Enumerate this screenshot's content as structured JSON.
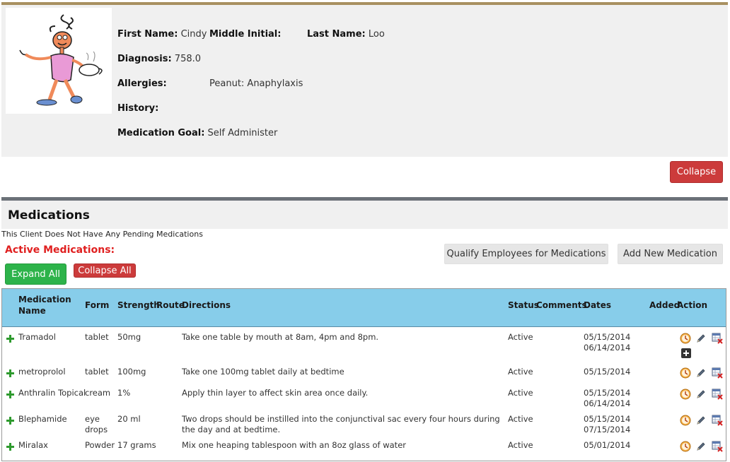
{
  "patient": {
    "first_name_label": "First Name:",
    "first_name": "Cindy",
    "middle_initial_label": "Middle Initial:",
    "middle_initial": "",
    "last_name_label": "Last Name:",
    "last_name": "Loo",
    "diagnosis_label": "Diagnosis:",
    "diagnosis": "758.0",
    "allergies_label": "Allergies:",
    "allergies": "Peanut: Anaphylaxis",
    "history_label": "History:",
    "history": "",
    "goal_label": "Medication Goal:",
    "goal": "Self Administer",
    "avatar_icon": "cartoon-character-icon"
  },
  "collapse_label": "Collapse",
  "medications": {
    "title": "Medications",
    "pending_text": "This Client Does Not Have Any Pending Medications",
    "active_title": "Active Medications:",
    "qualify_label": "Qualify Employees for Medications",
    "add_label": "Add New Medication",
    "expand_all_label": "Expand All",
    "collapse_all_label": "Collapse All",
    "columns": {
      "name": "Medication Name",
      "form": "Form",
      "strength": "Strength",
      "route": "Route",
      "directions": "Directions",
      "status": "Status",
      "comments": "Comments",
      "dates": "Dates",
      "added": "Added",
      "action": "Action"
    },
    "rows": [
      {
        "name": "Tramadol",
        "form": "tablet",
        "strength": "50mg",
        "route": "",
        "directions": "Take one table by mouth at 8am, 4pm and 8pm.",
        "status": "Active",
        "comments": "",
        "date1": "05/15/2014",
        "date2": "06/14/2014"
      },
      {
        "name": "metroprolol",
        "form": "tablet",
        "strength": "100mg",
        "route": "",
        "directions": "Take one 100mg tablet daily at bedtime",
        "status": "Active",
        "comments": "",
        "date1": "05/15/2014",
        "date2": ""
      },
      {
        "name": "Anthralin Topical",
        "form": "cream",
        "strength": "1%",
        "route": "",
        "directions": "Apply thin layer to affect skin area once daily.",
        "status": "Active",
        "comments": "",
        "date1": "05/15/2014",
        "date2": "06/14/2014"
      },
      {
        "name": "Blephamide",
        "form": "eye drops",
        "strength": "20 ml",
        "route": "",
        "directions": "Two drops should be instilled into the conjunctival sac every four hours during the day and at bedtime.",
        "status": "Active",
        "comments": "",
        "date1": "05/15/2014",
        "date2": "07/15/2014"
      },
      {
        "name": "Miralax",
        "form": "Powder",
        "strength": "17 grams",
        "route": "",
        "directions": "Mix one heaping tablespoon with an 8oz glass of water",
        "status": "Active",
        "comments": "",
        "date1": "05/01/2014",
        "date2": ""
      }
    ]
  },
  "icons": {
    "row_expand": "plus-icon",
    "schedule": "clock-icon",
    "edit": "pencil-icon",
    "delete": "delete-table-icon",
    "add_extra": "plus-square-icon"
  },
  "colors": {
    "accent_bar": "#a89060",
    "danger": "#cc3b3b",
    "success": "#2db34a",
    "table_header": "#87cdea",
    "active_title": "#e02020"
  }
}
